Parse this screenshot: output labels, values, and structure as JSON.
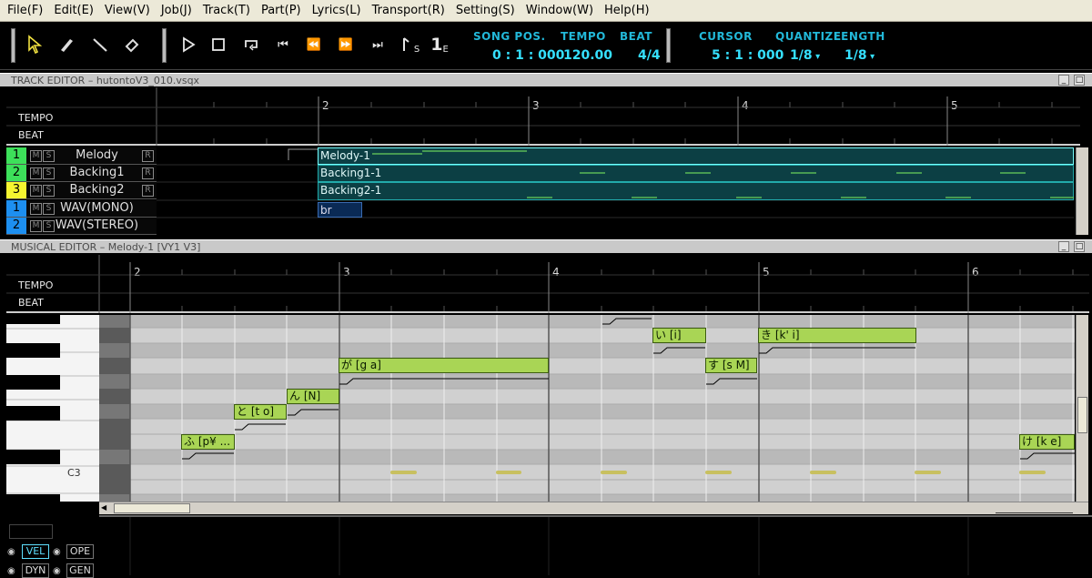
{
  "menu": [
    "File(F)",
    "Edit(E)",
    "View(V)",
    "Job(J)",
    "Track(T)",
    "Part(P)",
    "Lyrics(L)",
    "Transport(R)",
    "Setting(S)",
    "Window(W)",
    "Help(H)"
  ],
  "toolbar": {
    "song_pos_label": "SONG POS.",
    "song_pos_value": "0 : 1 : 000",
    "tempo_label": "TEMPO",
    "tempo_value": "120.00",
    "beat_label": "BEAT",
    "beat_value": "4/4",
    "cursor_label": "CURSOR",
    "cursor_value": "5 : 1 : 000",
    "quantize_label": "QUANTIZE",
    "quantize_value": "1/8",
    "length_label": "LENGTH",
    "length_value": "1/8",
    "start_marker_label": "1",
    "start_marker_sub": "S",
    "end_marker_label": "1",
    "end_marker_sub": "E"
  },
  "track_editor": {
    "title": "TRACK EDITOR – hutontoV3_010.vsqx",
    "tempo_label": "TEMPO",
    "beat_label": "BEAT",
    "ruler": [
      "2",
      "3",
      "4",
      "5"
    ],
    "tracks": [
      {
        "num": "1",
        "name": "Melody",
        "color": "#3de05a",
        "type": "vocal",
        "part": "Melody-1"
      },
      {
        "num": "2",
        "name": "Backing1",
        "color": "#3de05a",
        "type": "vocal",
        "part": "Backing1-1"
      },
      {
        "num": "3",
        "name": "Backing2",
        "color": "#f5f530",
        "type": "vocal",
        "part": "Backing2-1"
      },
      {
        "num": "1",
        "name": "WAV(MONO)",
        "color": "#1d8ff0",
        "type": "wav",
        "part": "br"
      },
      {
        "num": "2",
        "name": "WAV(STEREO)",
        "color": "#1d8ff0",
        "type": "wav",
        "part": ""
      }
    ],
    "mute_label": "M",
    "solo_label": "S",
    "r_label": "R"
  },
  "musical_editor": {
    "title": "MUSICAL EDITOR – Melody-1 [VY1 V3]",
    "tempo_label": "TEMPO",
    "beat_label": "BEAT",
    "ruler": [
      "2",
      "3",
      "4",
      "5",
      "6"
    ],
    "key_label": "C3",
    "notes": [
      {
        "lyric": "ふ [p¥ ..."
      },
      {
        "lyric": "と [t o]"
      },
      {
        "lyric": "ん [N]"
      },
      {
        "lyric": "が [g a]"
      },
      {
        "lyric": "い [i]"
      },
      {
        "lyric": "す [s M]"
      },
      {
        "lyric": "き [k' i]"
      },
      {
        "lyric": "け [k e]"
      }
    ]
  },
  "control_track": {
    "buttons": [
      "VEL",
      "OPE",
      "DYN",
      "GEN"
    ],
    "active": "VEL"
  },
  "colors": {
    "accent": "#35e0ff",
    "note_fill": "#a9d555",
    "part_fill": "#0c3f44"
  }
}
